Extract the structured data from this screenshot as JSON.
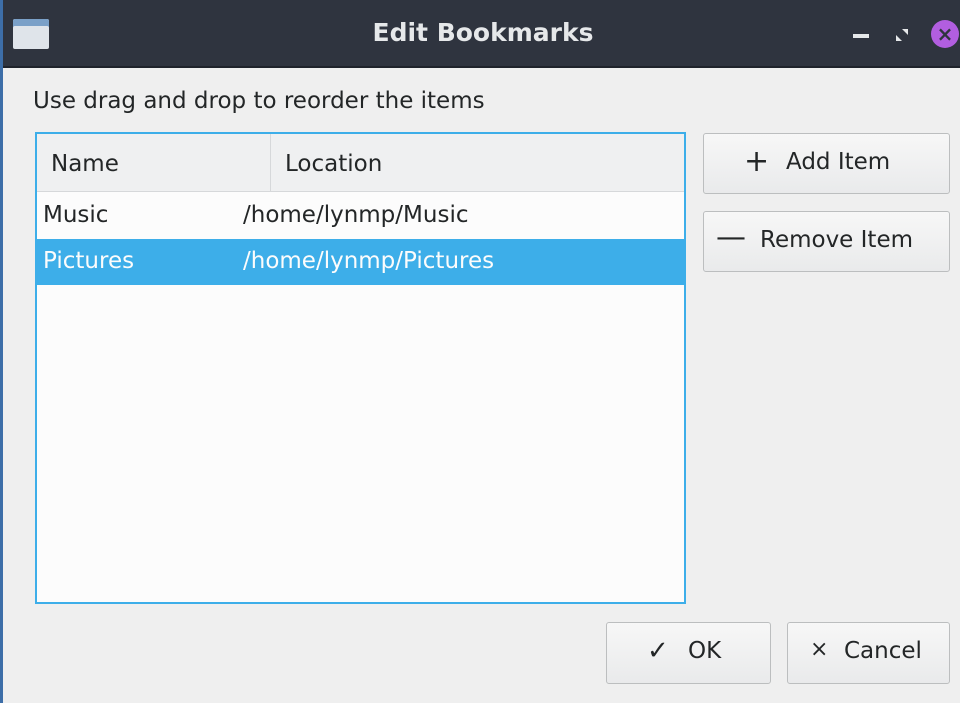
{
  "window": {
    "title": "Edit Bookmarks",
    "icons": {
      "app": "window-icon",
      "minimize": "minimize-icon",
      "maximize": "restore-icon",
      "close": "close-icon"
    }
  },
  "hint": "Use drag and drop to reorder the items",
  "table": {
    "columns": [
      "Name",
      "Location"
    ],
    "rows": [
      {
        "name": "Music",
        "location": "/home/lynmp/Music",
        "selected": false
      },
      {
        "name": "Pictures",
        "location": "/home/lynmp/Pictures",
        "selected": true
      }
    ]
  },
  "actions": {
    "add_label": "Add Item",
    "add_icon": "+",
    "remove_label": "Remove Item",
    "remove_icon": "—"
  },
  "footer": {
    "ok_label": "OK",
    "ok_icon": "✓",
    "cancel_label": "Cancel",
    "cancel_icon": "×"
  },
  "colors": {
    "titlebar": "#2f343f",
    "selection": "#3daee9",
    "close_button": "#b25ee0"
  }
}
